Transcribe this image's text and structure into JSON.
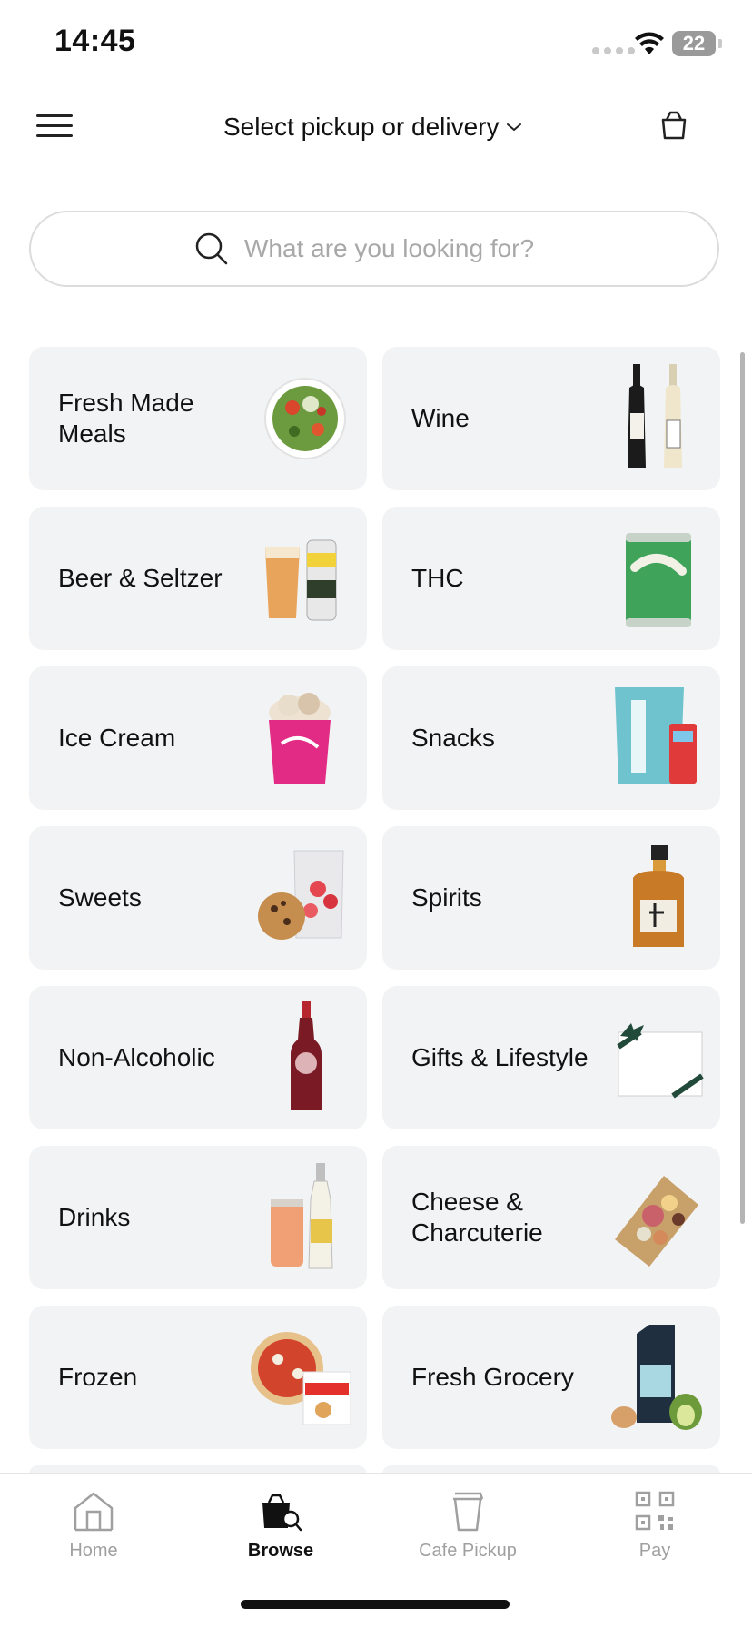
{
  "status_bar": {
    "time": "14:45",
    "battery": "22"
  },
  "header": {
    "menu_icon": "hamburger-menu-icon",
    "title": "Select pickup or delivery",
    "dropdown_icon": "chevron-down-icon",
    "cart_icon": "bag-icon"
  },
  "search": {
    "placeholder": "What are you looking for?",
    "icon": "search-icon",
    "value": ""
  },
  "categories": [
    {
      "label": "Fresh Made Meals",
      "icon": "salad-bowl-icon"
    },
    {
      "label": "Wine",
      "icon": "wine-bottles-icon"
    },
    {
      "label": "Beer & Seltzer",
      "icon": "beer-glass-and-can-icon"
    },
    {
      "label": "THC",
      "icon": "green-can-icon"
    },
    {
      "label": "Ice Cream",
      "icon": "ice-cream-pint-icon"
    },
    {
      "label": "Snacks",
      "icon": "chips-bag-icon"
    },
    {
      "label": "Sweets",
      "icon": "cookie-and-candy-bag-icon"
    },
    {
      "label": "Spirits",
      "icon": "whisky-bottle-icon"
    },
    {
      "label": "Non-Alcoholic",
      "icon": "soda-bottle-icon"
    },
    {
      "label": "Gifts & Lifestyle",
      "icon": "gift-card-icon"
    },
    {
      "label": "Drinks",
      "icon": "can-and-bottle-icon"
    },
    {
      "label": "Cheese & Charcuterie",
      "icon": "charcuterie-board-icon"
    },
    {
      "label": "Frozen",
      "icon": "pizza-and-nuggets-icon"
    },
    {
      "label": "Fresh Grocery",
      "icon": "oat-milk-and-produce-icon"
    }
  ],
  "tabs": [
    {
      "label": "Home",
      "icon": "home-icon",
      "active": false
    },
    {
      "label": "Browse",
      "icon": "shopping-bag-search-icon",
      "active": true
    },
    {
      "label": "Cafe Pickup",
      "icon": "coffee-cup-icon",
      "active": false
    },
    {
      "label": "Pay",
      "icon": "qr-code-icon",
      "active": false
    }
  ],
  "colors": {
    "tile_background": "#f2f3f4",
    "active_tab": "#111111",
    "inactive_tab": "#a0a0a0"
  }
}
